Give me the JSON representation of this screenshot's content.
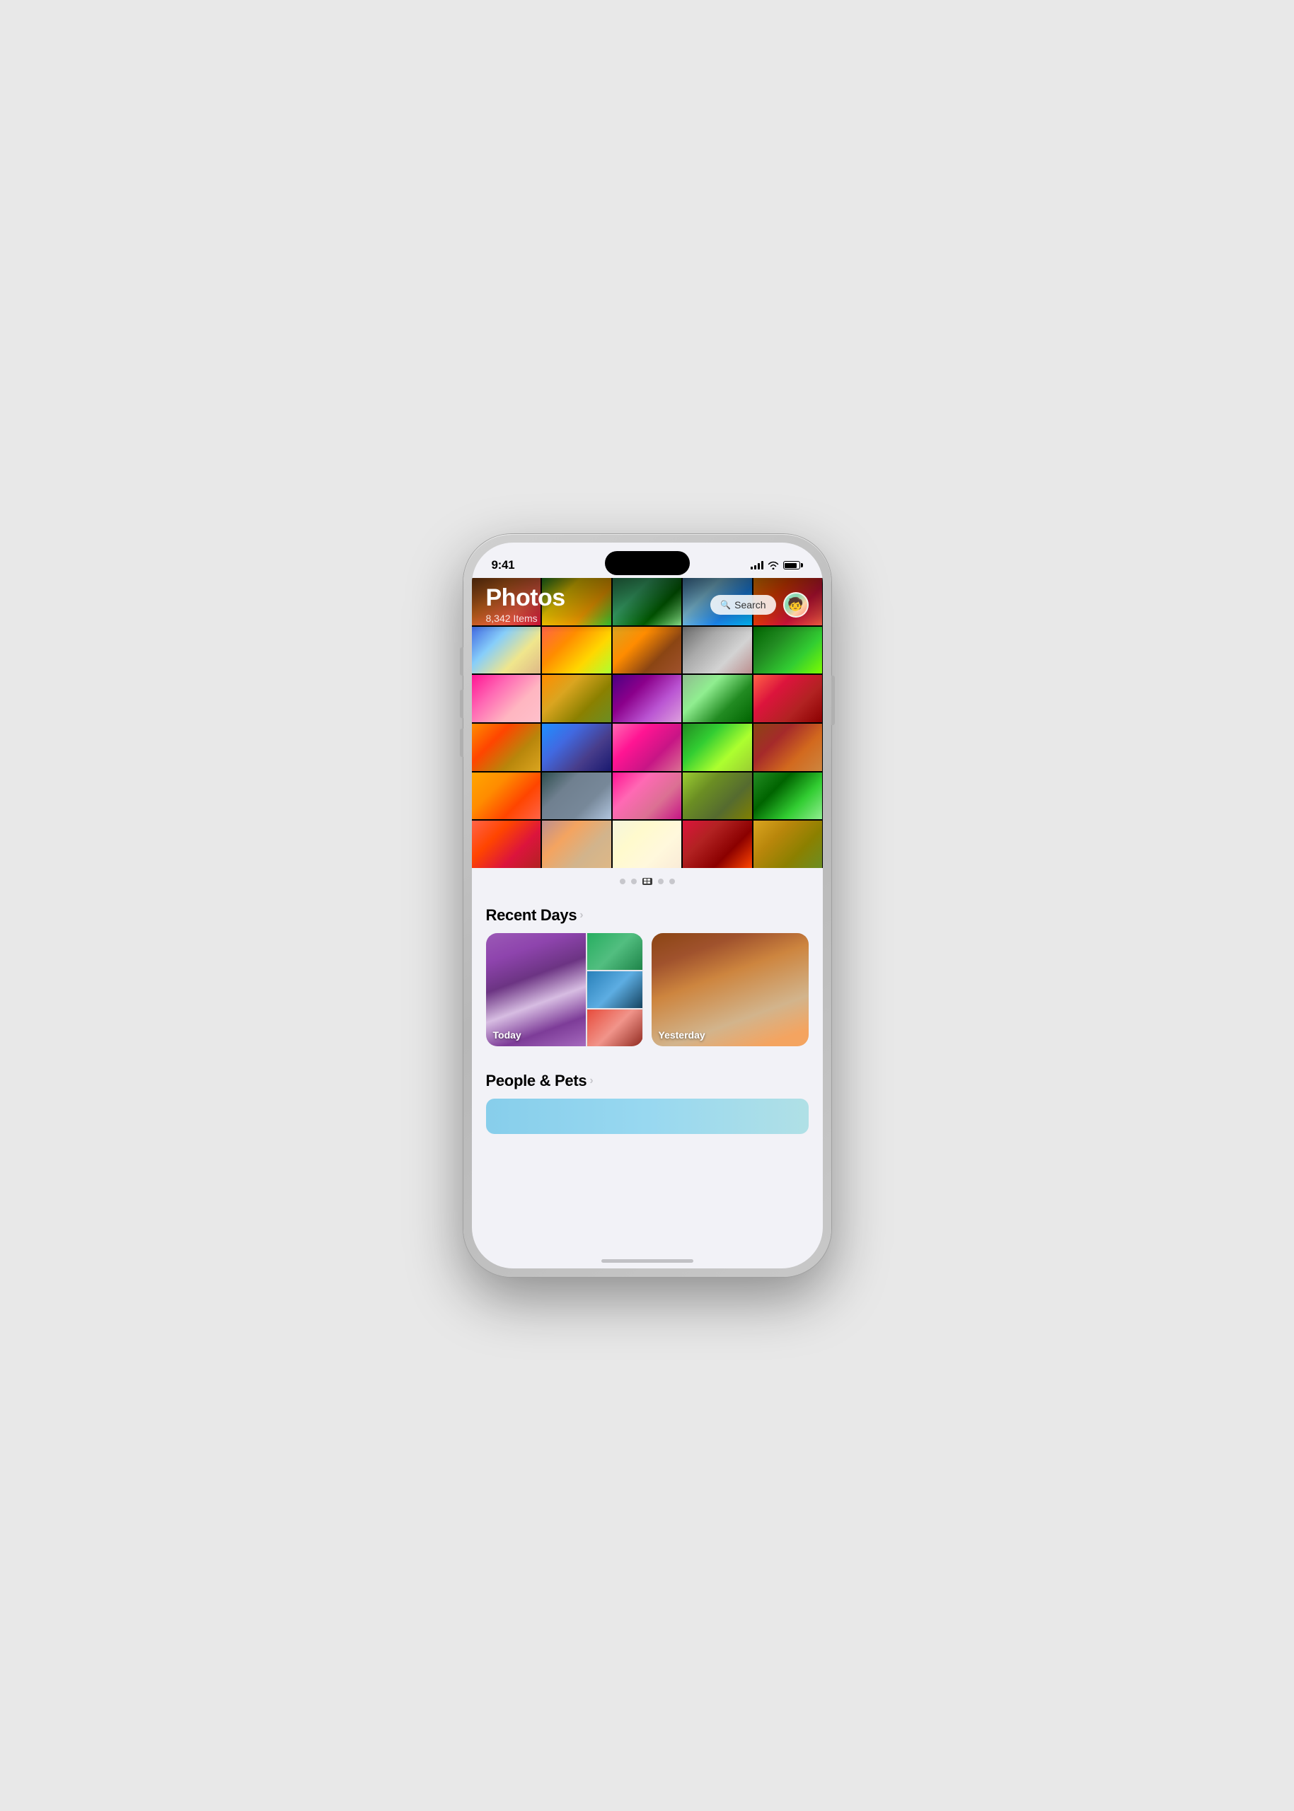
{
  "status_bar": {
    "time": "9:41",
    "signal_label": "Signal",
    "wifi_label": "WiFi",
    "battery_label": "Battery"
  },
  "header": {
    "title": "Photos",
    "item_count": "8,342 Items",
    "search_label": "Search",
    "avatar_emoji": "🧒"
  },
  "photo_grid": {
    "photos": [
      "p1",
      "p2",
      "p3",
      "p4",
      "p5",
      "p6",
      "p7",
      "p8",
      "p9",
      "p10",
      "p11",
      "p12",
      "p13",
      "p14",
      "p15",
      "p16",
      "p17",
      "p18",
      "p19",
      "p20",
      "p21",
      "p22",
      "p23",
      "p24",
      "p25",
      "p26",
      "p27",
      "p28",
      "p29",
      "p30"
    ]
  },
  "pagination": {
    "dots": [
      "inactive",
      "inactive",
      "grid",
      "inactive",
      "inactive"
    ]
  },
  "recent_days": {
    "title": "Recent Days",
    "chevron": ">",
    "cards": [
      {
        "label": "Today",
        "type": "today"
      },
      {
        "label": "Yesterday",
        "type": "yesterday"
      }
    ]
  },
  "people_pets": {
    "title": "People & Pets",
    "chevron": ">"
  }
}
